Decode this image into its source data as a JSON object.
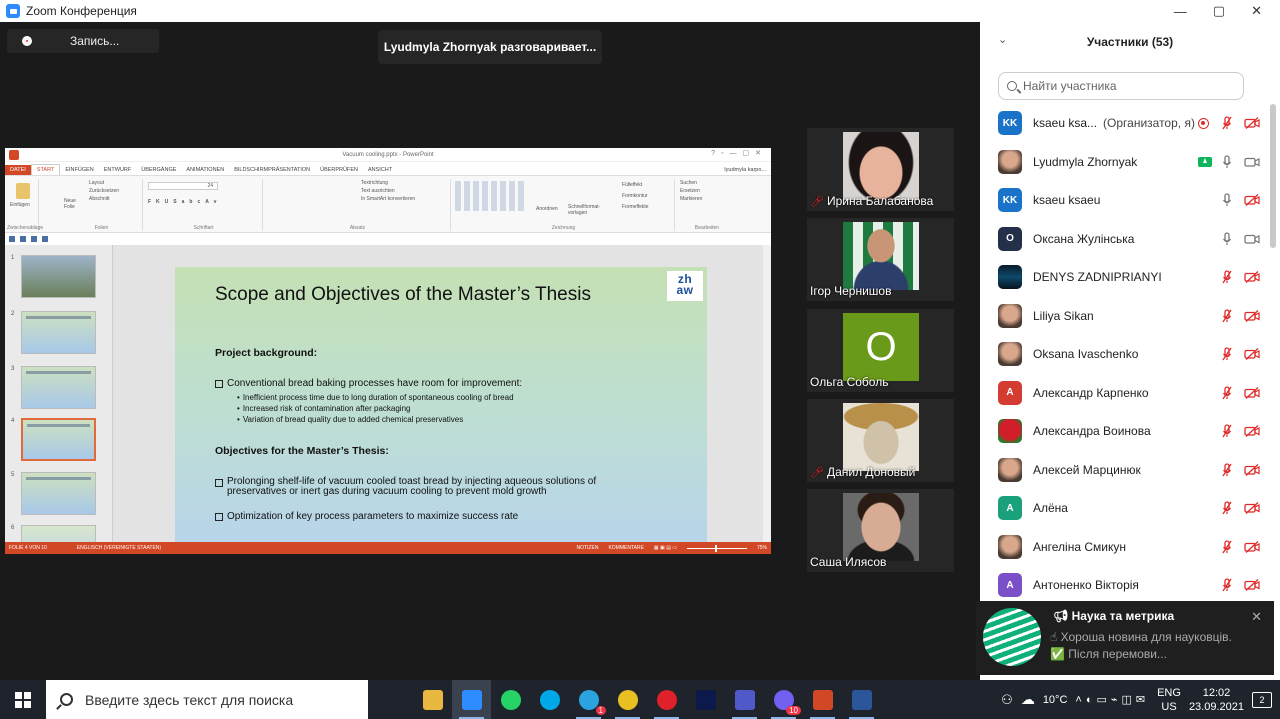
{
  "window": {
    "title": "Zoom Конференция",
    "controls": [
      "—",
      "▢",
      "✕"
    ]
  },
  "meeting": {
    "recording_label": "Запись...",
    "speaker_banner": "Lyudmyla Zhornyak разговаривает..."
  },
  "powerpoint": {
    "file_title": "Vacuum cooling.pptx - PowerPoint",
    "user": "lyudmyla karpo...",
    "tabs": [
      "DATEI",
      "START",
      "EINFÜGEN",
      "ENTWURF",
      "ÜBERGÄNGE",
      "ANIMATIONEN",
      "BILDSCHIRMPRÄSENTATION",
      "ÜBERPRÜFEN",
      "ANSICHT"
    ],
    "ribbon": {
      "clipboard": {
        "paste": "Einfügen",
        "group": "Zwischenablage"
      },
      "slides": {
        "new": "Neue Folie",
        "layout": "Layout",
        "reset": "Zurücksetzen",
        "section": "Abschnitt",
        "group": "Folien"
      },
      "font": {
        "size": "24",
        "group": "Schriftart"
      },
      "paragraph": {
        "dir": "Textrichtung",
        "align": "Text ausrichten",
        "smartart": "In SmartArt konvertieren",
        "group": "Absatz"
      },
      "drawing": {
        "arrange": "Anordnen",
        "quick": "Schnellformat-vorlagen",
        "fill": "Fülleffekt",
        "outline": "Formkontur",
        "effects": "Formeffekte",
        "group": "Zeichnung"
      },
      "editing": {
        "find": "Suchen",
        "replace": "Ersetzen",
        "select": "Markieren",
        "group": "Bearbeiten"
      }
    },
    "thumbnails": [
      "1",
      "2",
      "3",
      "4",
      "5",
      "6"
    ],
    "selected_slide": 4,
    "slide": {
      "title": "Scope and Objectives of the Master’s Thesis",
      "logo": "zh\naw",
      "heading1": "Project background:",
      "bullet1": "Conventional bread baking processes have room for improvement:",
      "sub1": "Inefficient process time due to long duration of spontaneous cooling of bread",
      "sub2": "Increased risk of contamination after packaging",
      "sub3": "Variation of bread quality due to added chemical preservatives",
      "heading2": "Objectives for the Master’s Thesis:",
      "bullet2a": "Prolonging shelf-life of vacuum cooled toast bread by injecting aqueous solutions of",
      "bullet2b": "preservatives or inert gas during vacuum cooling to prevent mold growth",
      "bullet3": "Optimization of key process parameters to maximize success rate"
    },
    "status": {
      "slide_of": "FOLIE 4 VON 10",
      "language": "ENGLISCH (VEREINIGTE STAATEN)",
      "notes": "NOTIZEN",
      "comments": "KOMMENTARE",
      "zoom": "75%"
    }
  },
  "video_tiles": [
    {
      "name": "Ирина Балабанова",
      "muted": true
    },
    {
      "name": "Ігор Чернишов",
      "muted": false
    },
    {
      "name": "Ольга Соболь",
      "muted": false,
      "initial": "О"
    },
    {
      "name": "Данил Доновый",
      "muted": true
    },
    {
      "name": "Саша Илясов",
      "muted": false
    }
  ],
  "participants_panel": {
    "title": "Участники (53)",
    "search_placeholder": "Найти участника",
    "participants": [
      {
        "name": "ksaeu ksa...",
        "role": "(Организатор, я)",
        "avatar": "KK",
        "avatar_color": "#1a73c8",
        "recording": true,
        "mic": "muted",
        "cam": "off"
      },
      {
        "name": "Lyudmyla Zhornyak",
        "avatar": "photo",
        "sharing": true,
        "mic": "on",
        "cam": "on"
      },
      {
        "name": "ksaeu ksaeu",
        "avatar": "KK",
        "avatar_color": "#1a73c8",
        "mic": "on",
        "cam": "off"
      },
      {
        "name": "Оксана Жулінська",
        "avatar": "О",
        "avatar_color": "#24304a",
        "mic": "on",
        "cam": "on"
      },
      {
        "name": "DENYS ZADNIPRIANYI",
        "avatar": "denys",
        "mic": "muted",
        "cam": "off"
      },
      {
        "name": "Liliya Sikan",
        "avatar": "photo",
        "mic": "muted",
        "cam": "off"
      },
      {
        "name": "Oksana Ivaschenko",
        "avatar": "photo",
        "mic": "muted",
        "cam": "off"
      },
      {
        "name": "Александр Карпенко",
        "avatar": "A",
        "avatar_color": "#d43c32",
        "mic": "muted",
        "cam": "off"
      },
      {
        "name": "Александра Воинова",
        "avatar": "rose",
        "mic": "muted",
        "cam": "off"
      },
      {
        "name": "Алексей Марцинюк",
        "avatar": "photo",
        "mic": "muted",
        "cam": "off"
      },
      {
        "name": "Алёна",
        "avatar": "A",
        "avatar_color": "#1aa07a",
        "mic": "muted",
        "cam": "off"
      },
      {
        "name": "Ангеліна Смикун",
        "avatar": "photo",
        "mic": "muted",
        "cam": "off"
      },
      {
        "name": "Антоненко Вікторія",
        "avatar": "A",
        "avatar_color": "#7a4fc8",
        "mic": "muted",
        "cam": "off"
      }
    ]
  },
  "notification": {
    "title": "Наука та метрика",
    "message": "☝ Хороша новина для науковців. ✅ Після перемови..."
  },
  "taskbar": {
    "search_placeholder": "Введите здесь текст для поиска",
    "apps": [
      "file-explorer",
      "zoom",
      "whatsapp",
      "skype",
      "telegram",
      "chrome",
      "opera",
      "photoshop",
      "teams",
      "viber",
      "powerpoint",
      "word"
    ],
    "telegram_badge": "1",
    "viber_badge": "10",
    "weather": "10°C",
    "lang": "ENG",
    "lang_sub": "US",
    "time": "12:02",
    "date": "23.09.2021",
    "notifications": "2",
    "colors": {
      "file-explorer": "#e8b840",
      "zoom": "#2d8cff",
      "whatsapp": "#25d366",
      "skype": "#00a8e8",
      "telegram": "#2aa3e0",
      "chrome": "#e8c022",
      "opera": "#e0202a",
      "photoshop": "#0b1a4a",
      "teams": "#5059c9",
      "viber": "#7360f2",
      "powerpoint": "#d24726",
      "word": "#2b579a"
    }
  }
}
